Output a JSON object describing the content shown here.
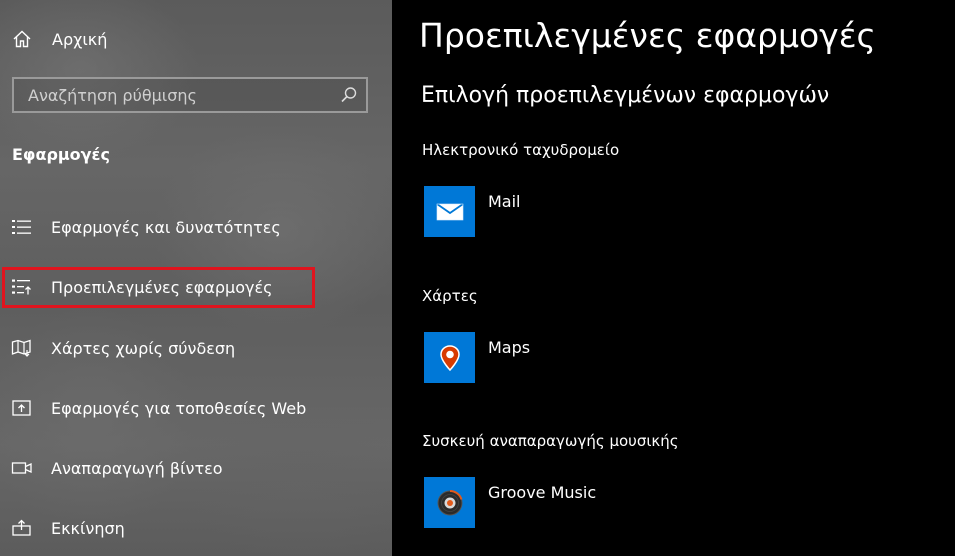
{
  "sidebar": {
    "home_label": "Αρχική",
    "search_placeholder": "Αναζήτηση ρύθμισης",
    "section_title": "Εφαρμογές",
    "items": [
      {
        "label": "Εφαρμογές και δυνατότητες",
        "icon": "list-icon"
      },
      {
        "label": "Προεπιλεγμένες εφαρμογές",
        "icon": "default-apps-icon",
        "selected": true
      },
      {
        "label": "Χάρτες χωρίς σύνδεση",
        "icon": "offline-map-icon"
      },
      {
        "label": "Εφαρμογές για τοποθεσίες Web",
        "icon": "web-app-icon"
      },
      {
        "label": "Αναπαραγωγή βίντεο",
        "icon": "video-icon"
      },
      {
        "label": "Εκκίνηση",
        "icon": "startup-icon"
      }
    ],
    "highlight_color": "#e0141e"
  },
  "main": {
    "title": "Προεπιλεγμένες εφαρμογές",
    "subtitle": "Επιλογή προεπιλεγμένων εφαρμογών",
    "defaults": [
      {
        "category": "Ηλεκτρονικό ταχυδρομείο",
        "app": "Mail",
        "icon": "mail-icon"
      },
      {
        "category": "Χάρτες",
        "app": "Maps",
        "icon": "maps-icon"
      },
      {
        "category": "Συσκευή αναπαραγωγής μουσικής",
        "app": "Groove Music",
        "icon": "groove-music-icon"
      }
    ],
    "tile_color": "#0078d7"
  }
}
